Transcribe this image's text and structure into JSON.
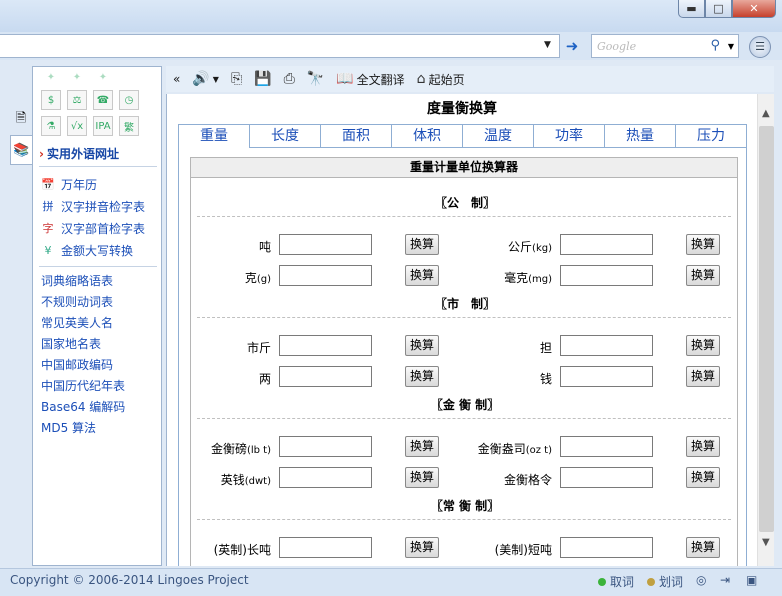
{
  "window": {
    "minimize": "▬",
    "maximize": "□",
    "close": "✕"
  },
  "address": {
    "value": "",
    "go_icon": "arrow-right-icon"
  },
  "search": {
    "placeholder": "Google"
  },
  "toolbar": {
    "collapse": "«",
    "translate_label": "全文翻译",
    "home_label": "起始页"
  },
  "sidebar": {
    "section_title": "实用外语网址",
    "tools": [
      {
        "label": "万年历",
        "icon": "calendar-icon"
      },
      {
        "label": "汉字拼音检字表",
        "icon": "pinyin-icon"
      },
      {
        "label": "汉字部首检字表",
        "icon": "radical-icon"
      },
      {
        "label": "金额大写转换",
        "icon": "money-icon"
      }
    ],
    "links": [
      "词典缩略语表",
      "不规则动词表",
      "常见英美人名",
      "国家地名表",
      "中国邮政编码",
      "中国历代纪年表",
      "Base64 编解码",
      "MD5 算法"
    ]
  },
  "page": {
    "title": "度量衡换算",
    "tabs": [
      "重量",
      "长度",
      "面积",
      "体积",
      "温度",
      "功率",
      "热量",
      "压力"
    ],
    "active_tab": "重量",
    "calculator_title": "重量计量单位换算器",
    "convert_label": "换算",
    "groups": [
      {
        "title": "〖公　制〗",
        "rows": [
          {
            "left": "吨",
            "left_unit": "",
            "right": "公斤",
            "right_unit": "(kg)"
          },
          {
            "left": "克",
            "left_unit": "(g)",
            "right": "毫克",
            "right_unit": "(mg)"
          }
        ]
      },
      {
        "title": "〖市　制〗",
        "rows": [
          {
            "left": "市斤",
            "left_unit": "",
            "right": "担",
            "right_unit": ""
          },
          {
            "left": "两",
            "left_unit": "",
            "right": "钱",
            "right_unit": ""
          }
        ]
      },
      {
        "title": "〖金 衡 制〗",
        "rows": [
          {
            "left": "金衡磅",
            "left_unit": "(lb t)",
            "right": "金衡盎司",
            "right_unit": "(oz t)"
          },
          {
            "left": "英钱",
            "left_unit": "(dwt)",
            "right": "金衡格令",
            "right_unit": ""
          }
        ]
      },
      {
        "title": "〖常 衡 制〗",
        "rows": [
          {
            "left": "(英制)长吨",
            "left_unit": "",
            "right": "(美制)短吨",
            "right_unit": ""
          }
        ]
      }
    ]
  },
  "status": {
    "copyright": "Copyright © 2006-2014 Lingoes Project",
    "pick_word": "取词",
    "select_word": "划词",
    "pick_color": "#3bb33b",
    "select_color": "#c0a040"
  }
}
